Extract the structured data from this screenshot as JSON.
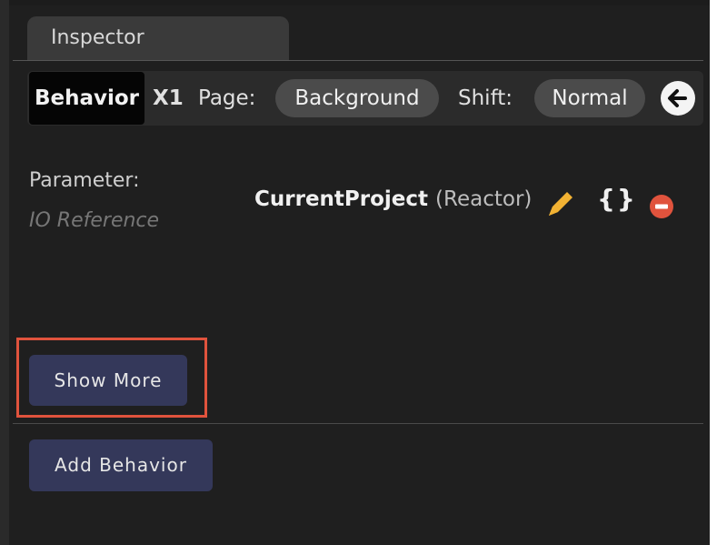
{
  "window": {
    "tab_label": "Inspector"
  },
  "toolbar": {
    "behavior_label": "Behavior",
    "x1_label": "X1",
    "page_label": "Page:",
    "page_value": "Background",
    "shift_label": "Shift:",
    "shift_value": "Normal",
    "back_icon": "arrow-left-icon"
  },
  "parameter": {
    "label": "Parameter:",
    "sublabel": "IO Reference",
    "value_name": "CurrentProject",
    "value_type": "(Reactor)",
    "icons": [
      "pencil-icon",
      "braces-icon",
      "remove-icon"
    ]
  },
  "buttons": {
    "show_more": "Show More",
    "add_behavior": "Add Behavior"
  },
  "colors": {
    "background": "#1f1f1f",
    "button": "#34385a",
    "pencil": "#f2b233",
    "remove": "#e0533d",
    "highlight": "#e0533d"
  }
}
